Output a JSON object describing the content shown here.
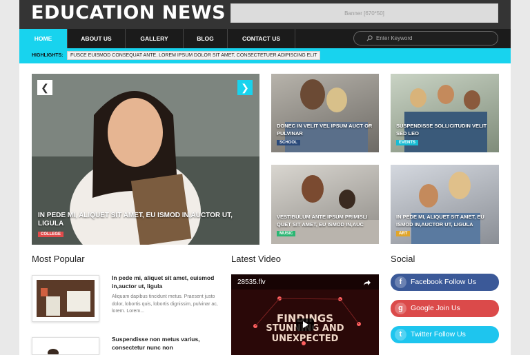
{
  "site": {
    "logo": "EDUCATION NEWS",
    "banner": "Banner [670*50]"
  },
  "nav": {
    "items": [
      "HOME",
      "ABOUT US",
      "GALLERY",
      "BLOG",
      "CONTACT US"
    ],
    "search_placeholder": "Enter Keyword"
  },
  "highlights": {
    "label": "HIGHLIGHTS:",
    "text": "FUSCE EUISMOD CONSEQUAT ANTE. LOREM IPSUM DOLOR SIT AMET, CONSECTETUER ADIPISCING ELIT"
  },
  "features": {
    "main": {
      "title": "IN PEDE MI, ALIQUET SIT AMET, EU ISMOD IN,AUCTOR UT, LIGULA",
      "badge": "COLLEGE"
    },
    "tiles": [
      {
        "title": "DONEC IN VELIT VEL IPSUM AUCT OR PULVINAR",
        "badge": "SCHOOL"
      },
      {
        "title": "SUSPENDISSE SOLLICITUDIN VELIT SED LEO",
        "badge": "EVENTS"
      },
      {
        "title": "VESTIBULUM ANTE IPSUM PRIMISLI QUET SIT AMET, EU ISMOD IN,AUC",
        "badge": "MUSIC"
      },
      {
        "title": "IN PEDE MI, ALIQUET SIT AMET, EU ISMOD IN,AUCTOR UT, LIGULA",
        "badge": "ART"
      }
    ]
  },
  "popular": {
    "title": "Most Popular",
    "posts": [
      {
        "title": "In pede mi, aliquet sit amet, euismod in,auctor ut, ligula",
        "excerpt": "Aliquam dapibus tincidunt metus. Praesent justo dolor, lobortis quis, lobortis dignissim, pulvinar ac, lorem. Lorem..."
      },
      {
        "title": "Suspendisse non metus varius, consectetur nunc non"
      }
    ]
  },
  "video": {
    "title": "Latest Video",
    "filename": "28535.flv",
    "line1": "FINDINGS",
    "line2": "STUNNING AND UNEXPECTED"
  },
  "social": {
    "title": "Social",
    "buttons": [
      {
        "label": "Facebook Follow Us",
        "icon": "f",
        "color": "#3b5998"
      },
      {
        "label": "Google Join Us",
        "icon": "g",
        "color": "#db4a4a"
      },
      {
        "label": "Twitter Follow Us",
        "icon": "t",
        "color": "#1ec5ee"
      }
    ]
  },
  "colors": {
    "accent": "#18d3ee",
    "header": "#343434",
    "nav": "#1b1b1b"
  }
}
